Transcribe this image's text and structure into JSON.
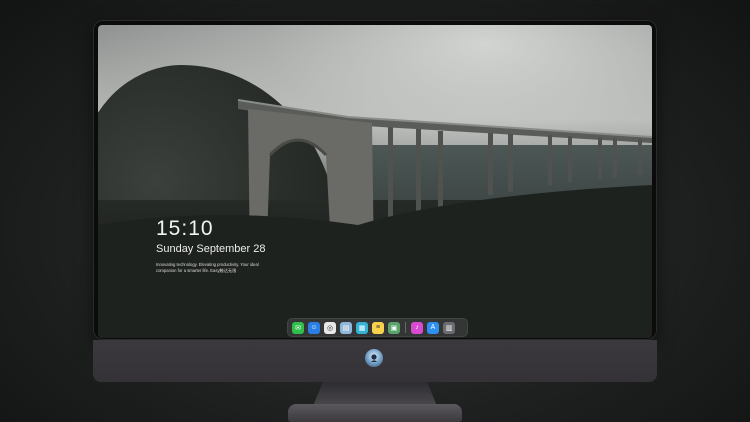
{
  "lockscreen": {
    "time": "15:10",
    "date": "Sunday September 28",
    "tagline": "Innovating technology. Elevating productivity. Your ideal companion for a smarter life. Easy触达无限"
  },
  "dock": {
    "items": [
      {
        "name": "messages-icon",
        "color": "#2fbf4a",
        "glyph": "✉"
      },
      {
        "name": "finder-icon",
        "color": "#2a7fe6",
        "glyph": "☺"
      },
      {
        "name": "safari-icon",
        "color": "#e8e8e8",
        "glyph": "◎"
      },
      {
        "name": "files-icon",
        "color": "#8fb7d8",
        "glyph": "▤"
      },
      {
        "name": "photos-icon",
        "color": "#35b3d6",
        "glyph": "▦"
      },
      {
        "name": "notes-icon",
        "color": "#f6d34a",
        "glyph": "≡"
      },
      {
        "name": "preview-icon",
        "color": "#5aa36a",
        "glyph": "▣"
      },
      {
        "name": "music-icon",
        "color": "#d84ad0",
        "glyph": "♪"
      },
      {
        "name": "app-store-icon",
        "color": "#2e8ff0",
        "glyph": "A"
      },
      {
        "name": "calculator-icon",
        "color": "#6c6c70",
        "glyph": "▥"
      }
    ]
  }
}
